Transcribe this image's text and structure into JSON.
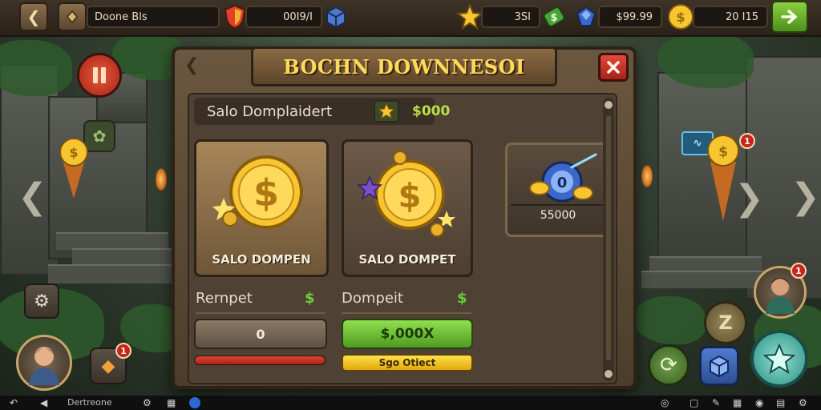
{
  "topbar": {
    "player_name": "Doone Bls",
    "resource_1": "00I9/I",
    "resource_2": "3SI",
    "resource_3": "$99.99",
    "resource_4": "20 I15"
  },
  "dialog": {
    "title": "BOCHN DOWNNESOI",
    "subheader_label": "Salo Domplaidert",
    "subheader_amount": "$000",
    "cards": [
      {
        "label": "SALO DOMPEN"
      },
      {
        "label": "SALO DOMPET"
      },
      {
        "value": "55000"
      }
    ],
    "left_column": {
      "label": "Rernpet",
      "cash": "$",
      "value": "0",
      "progress": 1.0
    },
    "right_column": {
      "label": "Dompeit",
      "cash": "$",
      "button": "$,000X",
      "sub_button": "Sgo Otiect"
    }
  },
  "hud": {
    "badges": [
      "1",
      "1",
      "1"
    ]
  },
  "bottom_bar": {
    "label": "Dertreone"
  },
  "colors": {
    "title_gold": "#ffd95a",
    "green_button": "#6acb3a",
    "close_red": "#d23a2c",
    "progress_red": "#c8251c",
    "yellow_button": "#f0c419"
  }
}
